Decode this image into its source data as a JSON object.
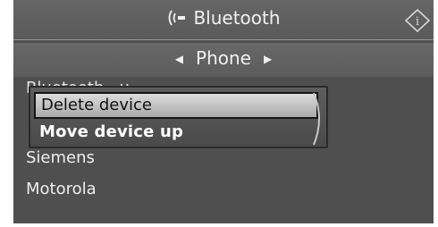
{
  "header": {
    "title": "Bluetooth",
    "left_icon": "bluetooth-signal-icon",
    "right_icon": "info-icon"
  },
  "subheader": {
    "title": "Phone",
    "prev_icon": "chevron-left-icon",
    "next_icon": "chevron-right-icon"
  },
  "list": {
    "behind_text": "Bluetooth...u",
    "items": [
      "Siemens",
      "Motorola"
    ]
  },
  "context_menu": {
    "items": [
      "Delete device",
      "Move device up"
    ],
    "selected_index": 0
  }
}
